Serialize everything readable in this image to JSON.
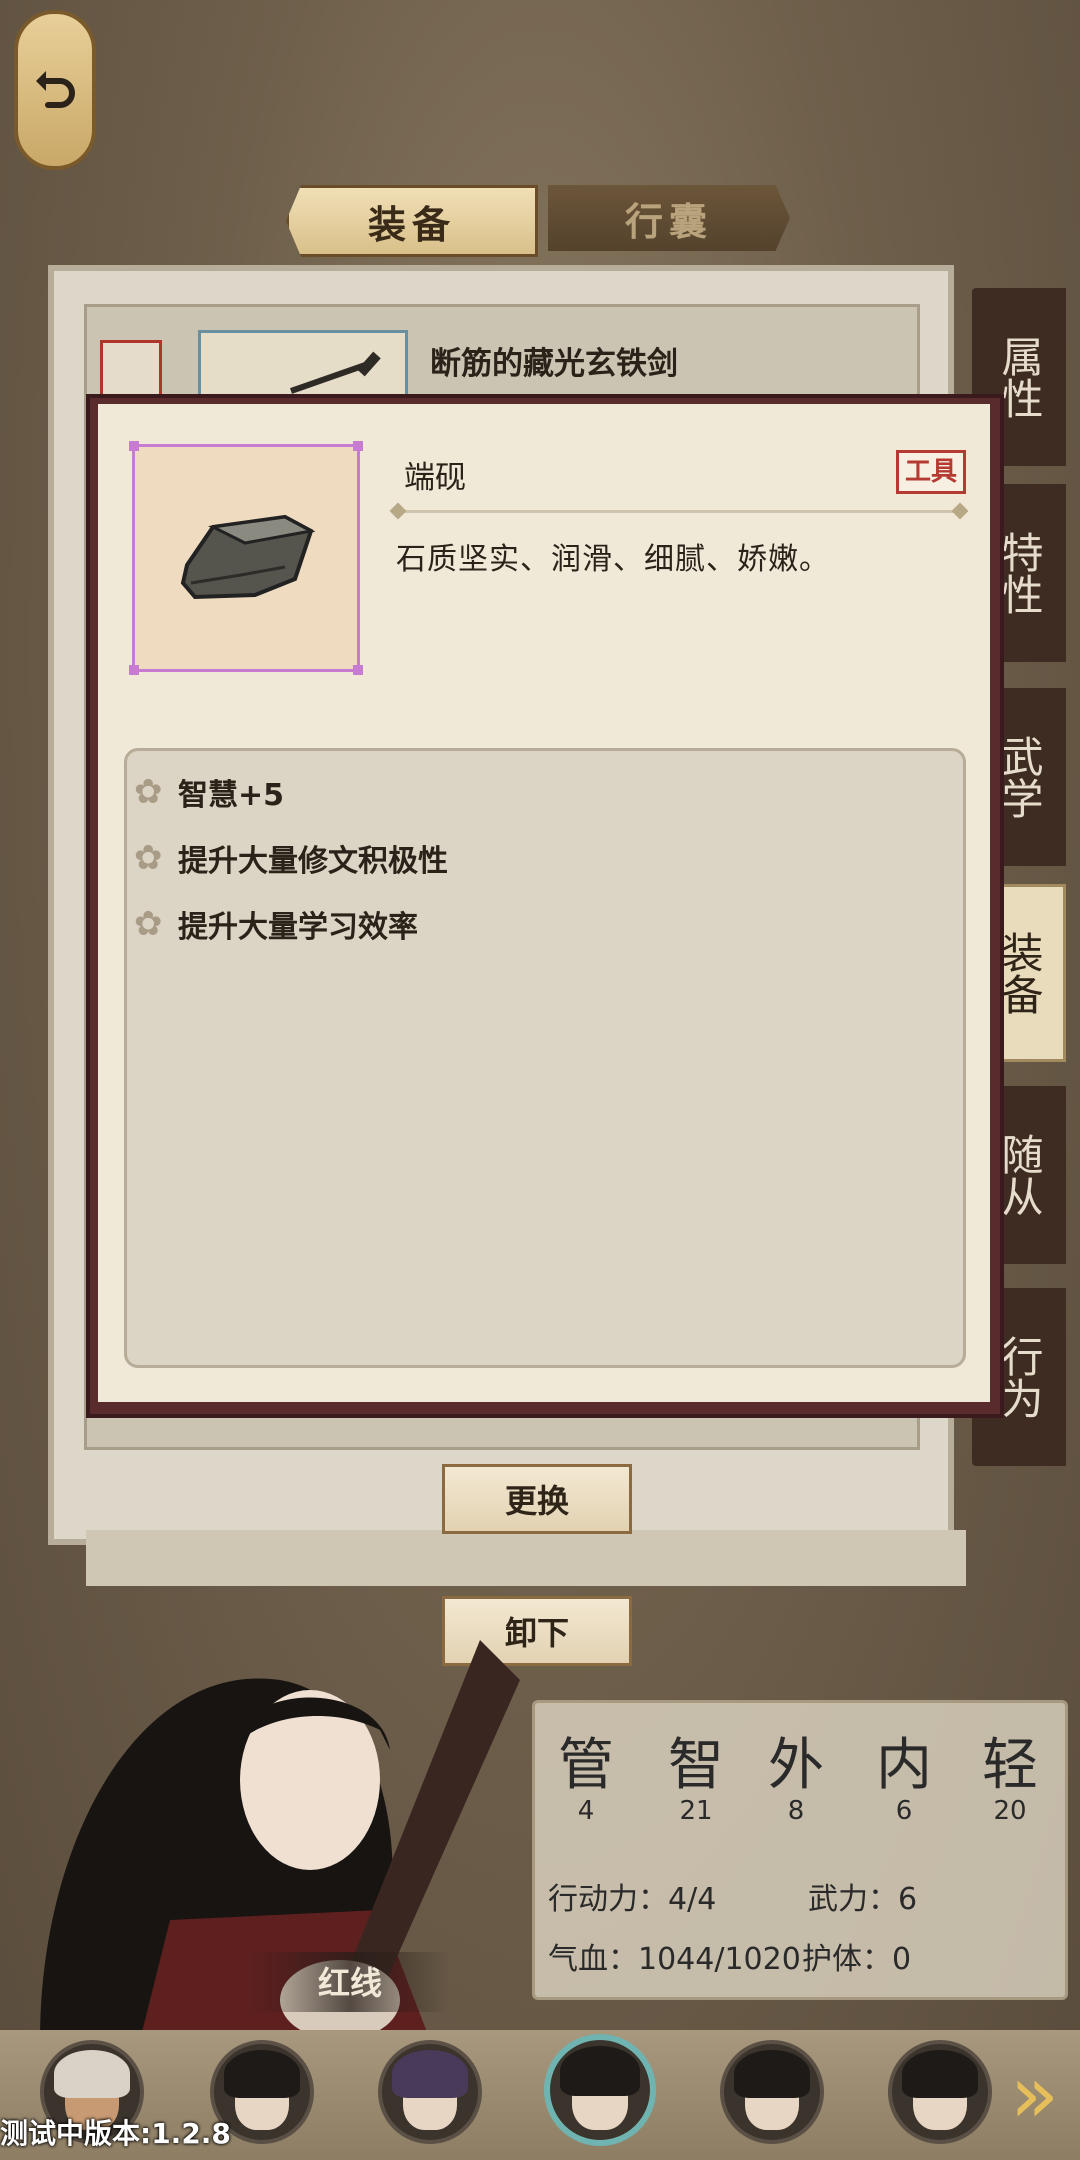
{
  "tabs": {
    "equip": "装备",
    "bag": "行囊"
  },
  "side_tabs": [
    {
      "label": "属性"
    },
    {
      "label": "特性"
    },
    {
      "label": "武学"
    },
    {
      "label": "装备",
      "active": true
    },
    {
      "label": "随从"
    },
    {
      "label": "行为"
    }
  ],
  "equipped": {
    "name": "断筋的藏光玄铁剑"
  },
  "detail": {
    "name": "端砚",
    "type": "工具",
    "description": "石质坚实、润滑、细腻、娇嫩。",
    "effects": [
      "智慧+5",
      "提升大量修文积极性",
      "提升大量学习效率"
    ]
  },
  "buttons": {
    "replace": "更换",
    "unequip": "卸下"
  },
  "character": {
    "name": "红线"
  },
  "stats": [
    {
      "label": "管",
      "value": "4"
    },
    {
      "label": "智",
      "value": "21"
    },
    {
      "label": "外",
      "value": "8"
    },
    {
      "label": "内",
      "value": "6"
    },
    {
      "label": "轻",
      "value": "20"
    }
  ],
  "info": {
    "action": "行动力：4/4",
    "force": "武力：6",
    "hp": "气血：1044/1020",
    "guard": "护体：0"
  },
  "version": "测试中版本:1.2.8",
  "colors": {
    "accent_active": "#6fb4b0",
    "item_rarity": "#c77cd1",
    "type_tag": "#b53a32"
  }
}
